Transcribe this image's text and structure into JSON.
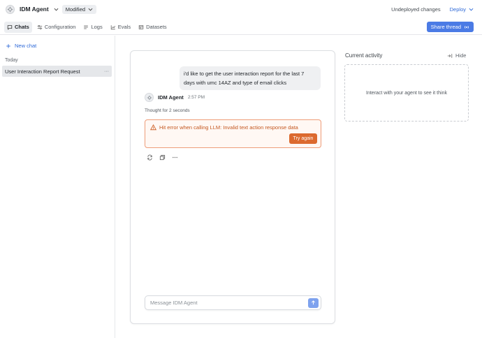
{
  "header": {
    "agent_name": "IDM Agent",
    "status": "Modified",
    "undeployed": "Undeployed changes",
    "deploy_label": "Deploy"
  },
  "tabs": [
    {
      "label": "Chats",
      "icon": "chat-icon",
      "active": true
    },
    {
      "label": "Configuration",
      "icon": "sliders-icon",
      "active": false
    },
    {
      "label": "Logs",
      "icon": "logs-icon",
      "active": false
    },
    {
      "label": "Evals",
      "icon": "chart-icon",
      "active": false
    },
    {
      "label": "Datasets",
      "icon": "table-icon",
      "active": false
    }
  ],
  "share_label": "Share thread",
  "sidebar": {
    "new_chat_label": "New chat",
    "section_label": "Today",
    "chats": [
      {
        "title": "User Interaction Report Request",
        "selected": true
      }
    ],
    "more_label": "···"
  },
  "conversation": {
    "user_message": "i'd like to get the user interaction report for the last 7 days with umc 14AZ and type of email clicks",
    "agent_name": "IDM Agent",
    "time": "2:57 PM",
    "thought": "Thought for 2 seconds",
    "error_text": "Hit error when calling LLM: Invalid text action response data",
    "retry_label": "Try again",
    "composer_placeholder": "Message IDM Agent"
  },
  "activity": {
    "title": "Current activity",
    "hide_label": "Hide",
    "empty_text": "Interact with your agent to see it think"
  },
  "colors": {
    "accent": "#4b7be5",
    "error": "#dc6a2f",
    "error_border": "#ee9d79"
  }
}
